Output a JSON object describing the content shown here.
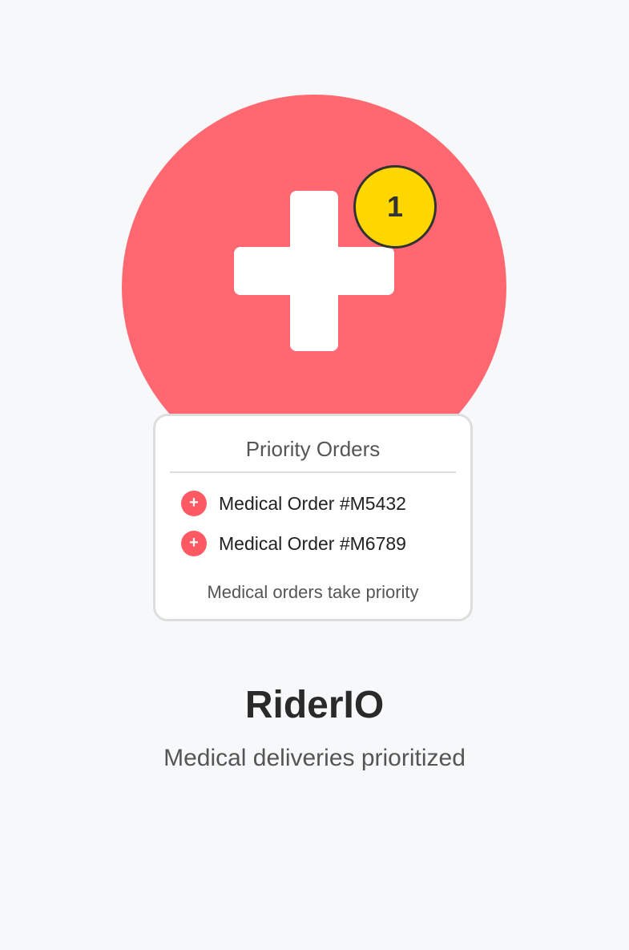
{
  "hero": {
    "icon": "medical-cross-icon",
    "color": "#ff6870",
    "badge_count": "1",
    "badge_color": "#ffd700"
  },
  "orders_card": {
    "title": "Priority Orders",
    "items": [
      {
        "icon": "plus-icon",
        "icon_glyph": "+",
        "label": "Medical Order #M5432"
      },
      {
        "icon": "plus-icon",
        "icon_glyph": "+",
        "label": "Medical Order #M6789"
      }
    ],
    "footer": "Medical orders take priority"
  },
  "brand": {
    "name": "RiderIO",
    "tagline": "Medical deliveries prioritized"
  },
  "colors": {
    "background": "#f7f8fa",
    "accent": "#ff5a63",
    "text_primary": "#2a2a2a",
    "text_secondary": "#555555"
  }
}
